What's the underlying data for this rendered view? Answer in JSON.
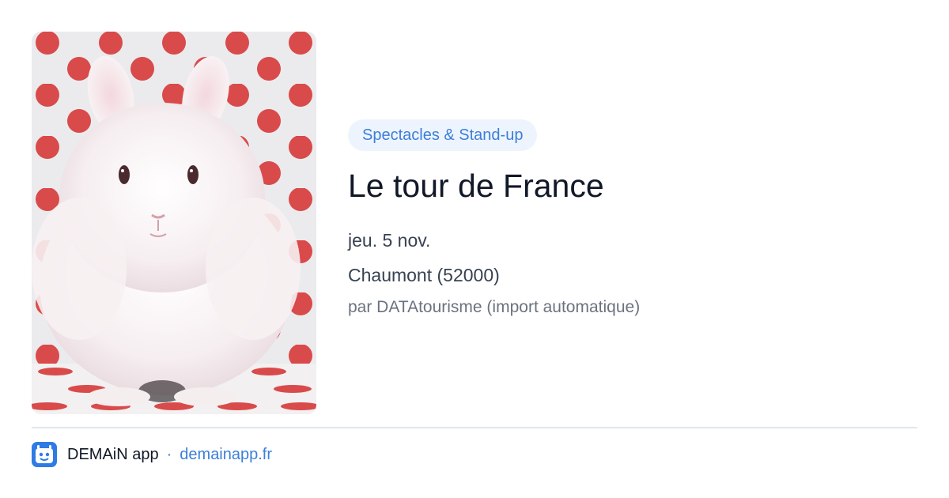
{
  "event": {
    "category": "Spectacles & Stand-up",
    "title": "Le tour de France",
    "date": "jeu. 5 nov.",
    "location": "Chaumont (52000)",
    "source": "par DATAtourisme (import automatique)",
    "image": "white-fluffy-rabbit-red-polka-dot-photo"
  },
  "footer": {
    "logo_icon": "demain-app-logo-icon",
    "app_name": "DEMAiN app",
    "separator": "·",
    "url": "demainapp.fr"
  },
  "colors": {
    "accent": "#3b7fd9",
    "badge_bg": "#eef4fd",
    "divider": "#dfe8ec",
    "polka_dot": "#d94a4a"
  }
}
